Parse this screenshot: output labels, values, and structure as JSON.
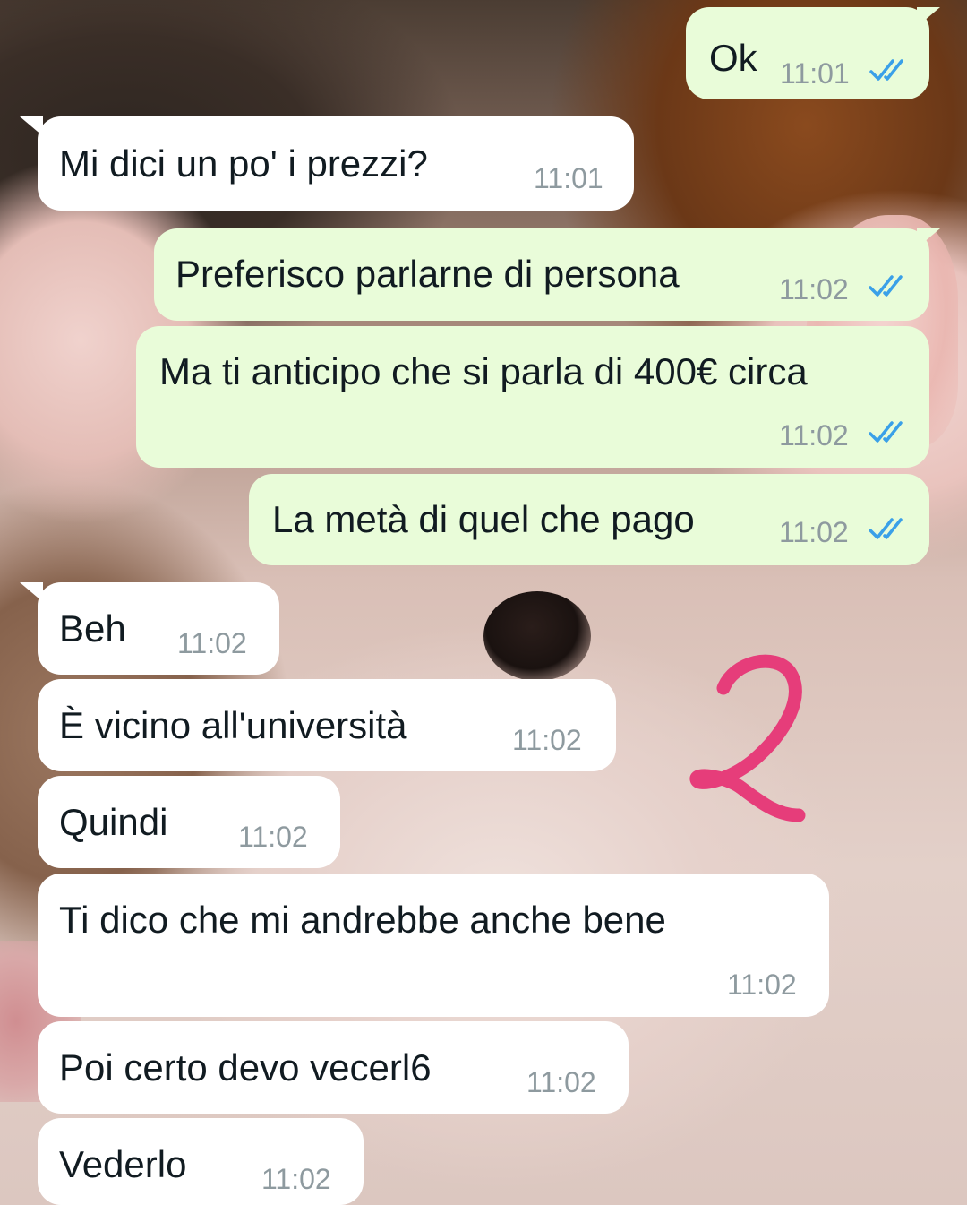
{
  "chat": {
    "messages": [
      {
        "direction": "outgoing",
        "text": "Ok",
        "time": "11:01",
        "status": "read",
        "status_icon": "double-check-read-icon"
      },
      {
        "direction": "incoming",
        "text": "Mi dici un po' i prezzi?",
        "time": "11:01"
      },
      {
        "direction": "outgoing",
        "text": "Preferisco parlarne di persona",
        "time": "11:02",
        "status": "read",
        "status_icon": "double-check-read-icon"
      },
      {
        "direction": "outgoing",
        "text": "Ma ti anticipo che si parla di 400€ circa",
        "time": "11:02",
        "status": "read",
        "status_icon": "double-check-read-icon"
      },
      {
        "direction": "outgoing",
        "text": "La metà di quel che pago",
        "time": "11:02",
        "status": "read",
        "status_icon": "double-check-read-icon"
      },
      {
        "direction": "incoming",
        "text": "Beh",
        "time": "11:02"
      },
      {
        "direction": "incoming",
        "text": "È vicino all'università",
        "time": "11:02"
      },
      {
        "direction": "incoming",
        "text": "Quindi",
        "time": "11:02"
      },
      {
        "direction": "incoming",
        "text": "Ti dico che mi andrebbe anche bene",
        "time": "11:02"
      },
      {
        "direction": "incoming",
        "text": "Poi certo devo vecerl6",
        "time": "11:02"
      },
      {
        "direction": "incoming",
        "text": "Vederlo",
        "time": "11:02"
      }
    ]
  },
  "annotation": {
    "mark": "2",
    "color": "#e63d7a"
  },
  "colors": {
    "outgoing_bubble": "#e9fcd9",
    "incoming_bubble": "#ffffff",
    "read_ticks": "#3aa0e8",
    "timestamp": "#8e9a9f"
  }
}
